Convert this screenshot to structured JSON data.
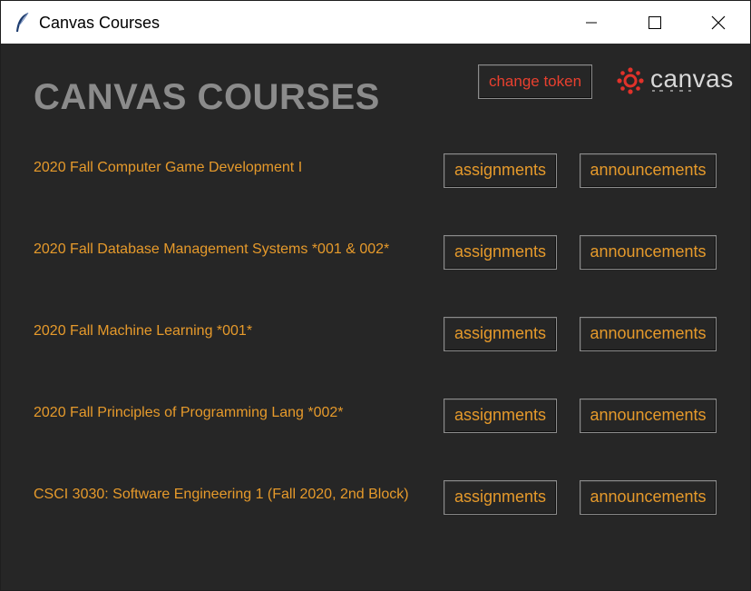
{
  "window": {
    "title": "Canvas Courses",
    "minimize_glyph": "—",
    "maximize_glyph": "☐",
    "close_glyph": "✕"
  },
  "header": {
    "title": "CANVAS COURSES",
    "change_token_label": "change token",
    "logo_text": "canvas"
  },
  "courses": [
    {
      "name": "2020 Fall Computer Game Development I",
      "assignments_label": "assignments",
      "announcements_label": "announcements"
    },
    {
      "name": "2020 Fall Database Management Systems *001 & 002*",
      "assignments_label": "assignments",
      "announcements_label": "announcements"
    },
    {
      "name": "2020 Fall Machine Learning *001*",
      "assignments_label": "assignments",
      "announcements_label": "announcements"
    },
    {
      "name": "2020 Fall Principles of Programming Lang *002*",
      "assignments_label": "assignments",
      "announcements_label": "announcements"
    },
    {
      "name": "CSCI 3030: Software Engineering 1 (Fall 2020, 2nd Block)",
      "assignments_label": "assignments",
      "announcements_label": "announcements"
    }
  ],
  "colors": {
    "background": "#262626",
    "accent": "#e69a2b",
    "token": "#e8402f",
    "title": "#8b8b8b"
  },
  "icons": {
    "app": "feather-icon",
    "logo": "canvas-logo-icon"
  }
}
